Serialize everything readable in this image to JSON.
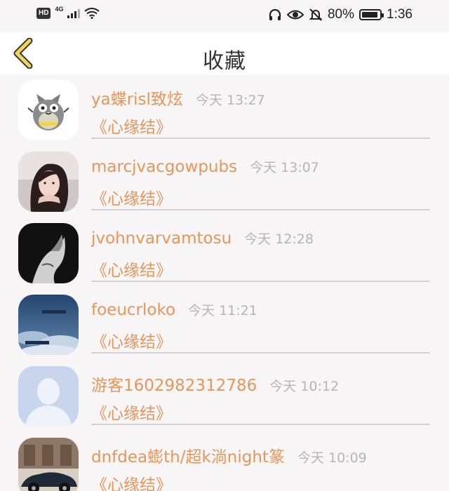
{
  "status_bar": {
    "hd": "HD",
    "network": "4G",
    "battery": "80%",
    "time": "1:36"
  },
  "header": {
    "title": "收藏",
    "back_icon": "chevron-left-icon"
  },
  "colors": {
    "accent": "#e5965a",
    "back_arrow_fill": "#f3d35a",
    "time_text": "#b7b4b4"
  },
  "items": [
    {
      "name": "ya蝶risl致炫",
      "time": "今天 13:27",
      "subtitle": "《心缘结》",
      "avatar": "cartoon-totoro-avatar"
    },
    {
      "name": "marcjvacgowpubs",
      "time": "今天 13:07",
      "subtitle": "《心缘结》",
      "avatar": "woman-photo-avatar"
    },
    {
      "name": "jvohnvarvamtosu",
      "time": "今天 12:28",
      "subtitle": "《心缘结》",
      "avatar": "bw-portrait-avatar"
    },
    {
      "name": "foeucrloko",
      "time": "今天 11:21",
      "subtitle": "《心缘结》",
      "avatar": "sky-clouds-avatar"
    },
    {
      "name": "游客1602982312786",
      "time": "今天 10:12",
      "subtitle": "《心缘结》",
      "avatar": "default-user-avatar"
    },
    {
      "name": "dnfdea蟛th/超k淌night篆",
      "time": "今天 10:09",
      "subtitle": "《心缘结》",
      "avatar": "sports-car-avatar"
    }
  ]
}
